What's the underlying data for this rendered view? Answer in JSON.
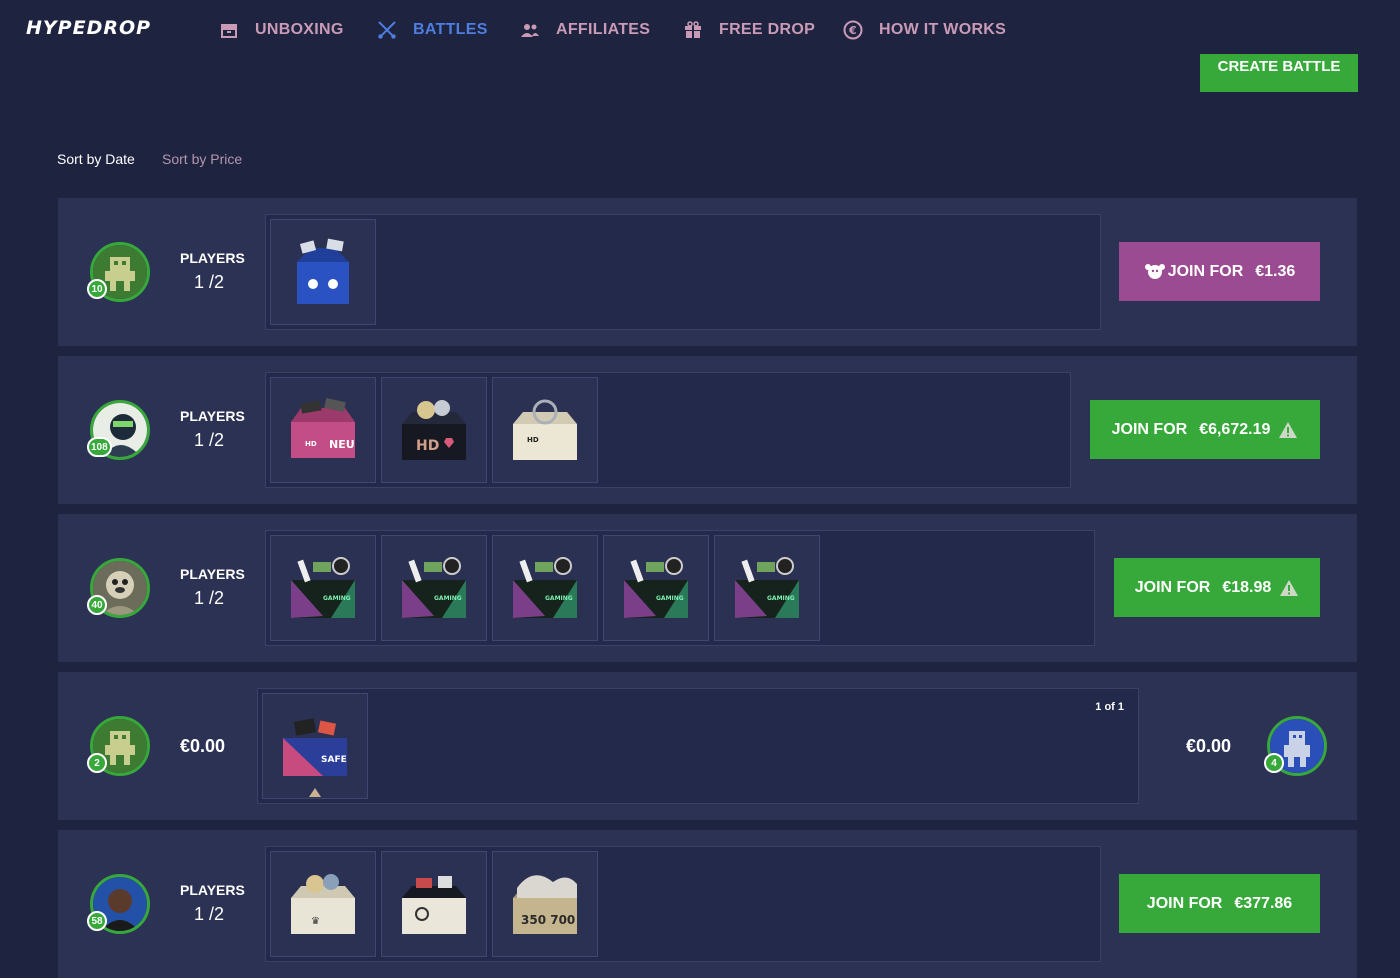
{
  "nav": {
    "logo": "HYPEDROP",
    "items": [
      {
        "label": "UNBOXING",
        "icon": "box-icon",
        "active": false
      },
      {
        "label": "BATTLES",
        "icon": "crossed-swords-icon",
        "active": true
      },
      {
        "label": "AFFILIATES",
        "icon": "users-icon",
        "active": false
      },
      {
        "label": "FREE DROP",
        "icon": "gift-icon",
        "active": false
      },
      {
        "label": "HOW IT WORKS",
        "icon": "coin-icon",
        "active": false
      }
    ]
  },
  "create_battle_label": "CREATE BATTLE",
  "sort": {
    "by_date": "Sort by Date",
    "by_price": "Sort by Price",
    "active": "by_date"
  },
  "battles": [
    {
      "level": "10",
      "avatar": "green-robot-avatar",
      "players_label": "PLAYERS",
      "players": "1 /2",
      "cases": [
        "blue-cash-box"
      ],
      "join_label": "JOIN FOR",
      "join_price": "€1.36",
      "join_style": "pink",
      "warning": false
    },
    {
      "level": "108",
      "avatar": "gamer-avatar",
      "players_label": "PLAYERS",
      "players": "1 /2",
      "cases": [
        "pink-sneaker-box",
        "luxury-watch-box",
        "car-box"
      ],
      "join_label": "JOIN FOR",
      "join_price": "€6,672.19",
      "join_style": "green",
      "warning": true
    },
    {
      "level": "40",
      "avatar": "pug-avatar",
      "players_label": "PLAYERS",
      "players": "1 /2",
      "cases": [
        "gaming-tech-box",
        "gaming-tech-box",
        "gaming-tech-box",
        "gaming-tech-box",
        "gaming-tech-box"
      ],
      "join_label": "JOIN FOR",
      "join_price": "€18.98",
      "join_style": "green",
      "warning": true
    },
    {
      "level": "2",
      "avatar": "green-robot-avatar",
      "left_amount": "€0.00",
      "right_amount": "€0.00",
      "right_level": "4",
      "right_avatar": "blue-robot-avatar",
      "round": "1 of 1",
      "cases": [
        "street-box"
      ],
      "in_progress": true
    },
    {
      "level": "58",
      "avatar": "person-avatar",
      "players_label": "PLAYERS",
      "players": "1 /2",
      "cases": [
        "watch-box",
        "streetwear-box",
        "yeezy-box"
      ],
      "join_label": "JOIN FOR",
      "join_price": "€377.86",
      "join_style": "green",
      "warning": false
    }
  ],
  "colors": {
    "background": "#1e2340",
    "row": "#2c3253",
    "accent_green": "#37a93a",
    "accent_pink": "#9a4b91",
    "nav_text": "#c99bb6",
    "nav_active": "#4d7ee0"
  }
}
